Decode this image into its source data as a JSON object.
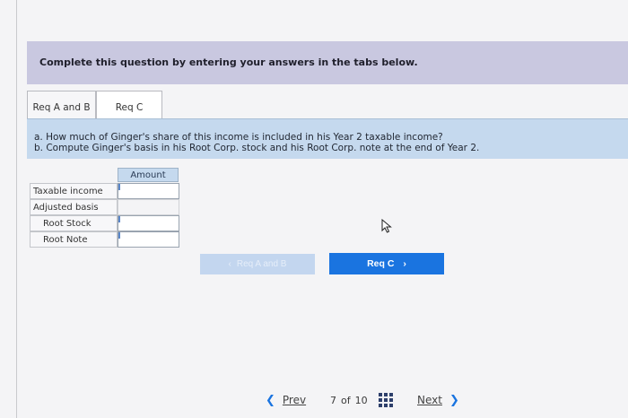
{
  "instruction": "Complete this question by entering your answers in the tabs below.",
  "tabs": [
    {
      "label": "Req A and B",
      "active": true
    },
    {
      "label": "Req C",
      "active": false
    }
  ],
  "question": {
    "line_a": "a. How much of Ginger's share of this income is included in his Year 2 taxable income?",
    "line_b": "b. Compute Ginger's basis in his Root Corp. stock and his Root Corp. note at the end of Year 2."
  },
  "table": {
    "header": "Amount",
    "rows": [
      {
        "label": "Taxable income",
        "value": ""
      },
      {
        "label": "Adjusted basis",
        "value": ""
      },
      {
        "label": "Root Stock",
        "value": ""
      },
      {
        "label": "Root Note",
        "value": ""
      }
    ]
  },
  "req_nav": {
    "prev_label": "Req A and B",
    "next_label": "Req C"
  },
  "footer": {
    "prev_label": "Prev",
    "page_current": "7",
    "page_of": "of",
    "page_total": "10",
    "next_label": "Next"
  },
  "colors": {
    "accent": "#1a74e0",
    "instruction_bg": "#c9c8e0",
    "question_bg": "#c5d9ee"
  },
  "icons": {
    "prev": "chevron-left-icon",
    "next": "chevron-right-icon",
    "grid": "grid-icon",
    "cursor": "mouse-pointer-icon"
  }
}
